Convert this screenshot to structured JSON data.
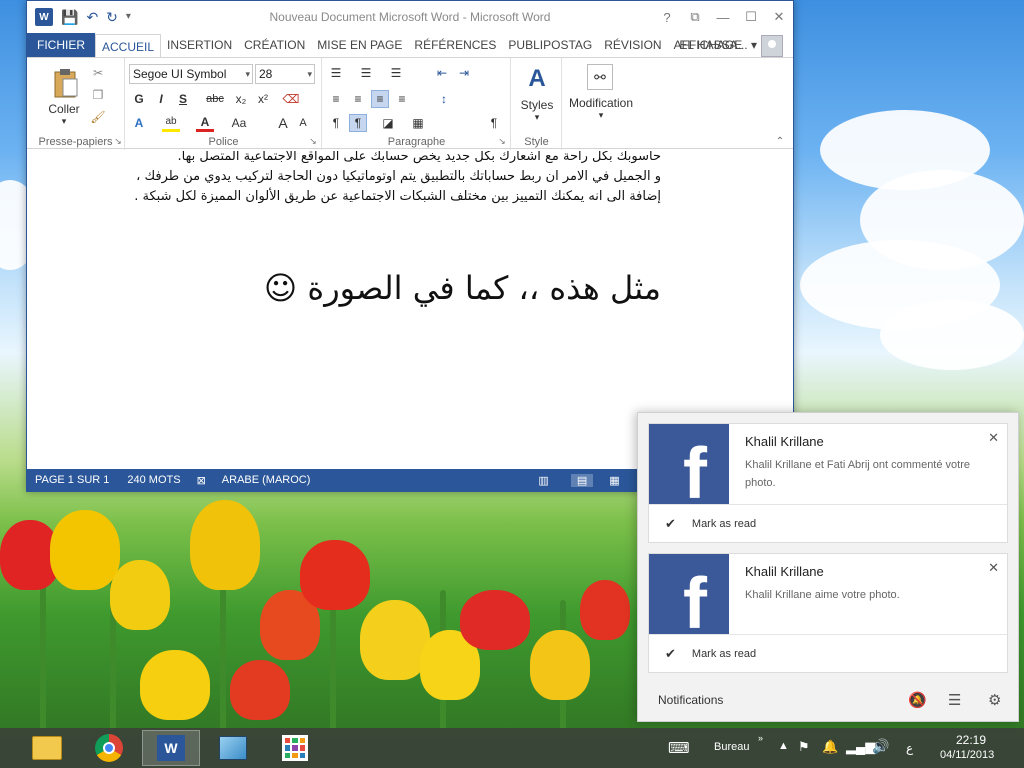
{
  "window": {
    "title": "Nouveau Document Microsoft Word - Microsoft Word",
    "controls": [
      "?",
      "⧉",
      "—",
      "☐",
      "✕"
    ]
  },
  "quick_access": {
    "app_icon_letter": "W",
    "save_icon": "💾",
    "undo_icon": "↶",
    "redo_icon": "↻",
    "customize_icon": "▾"
  },
  "tabs": [
    "FICHIER",
    "ACCUEIL",
    "INSERTION",
    "CRÉATION",
    "MISE EN PAGE",
    "RÉFÉRENCES",
    "PUBLIPOSTAG",
    "RÉVISION",
    "AFFICHAGE"
  ],
  "user": {
    "name": "EL HASSA... ▾"
  },
  "ribbon": {
    "clipboard": {
      "label": "Presse-papiers",
      "paste_label": "Coller"
    },
    "font": {
      "label": "Police",
      "font_name": "Segoe UI Symbol",
      "font_size": "28",
      "bold": "G",
      "italic": "I",
      "underline": "S",
      "strike": "abc",
      "sub": "x₂",
      "sup": "x²",
      "case": "Aa",
      "grow": "A",
      "shrink": "A"
    },
    "paragraph": {
      "label": "Paragraphe"
    },
    "styles": {
      "label": "Style",
      "styles_label": "Styles"
    },
    "editing": {
      "modification_label": "Modification"
    }
  },
  "document": {
    "lines": [
      "حاسوبك بكل راحة مع اشعارك بكل جديد يخص حسابك على المواقع الاجتماعية المتصل بها.",
      "و الجميل في الامر ان ربط حساباتك بالتطبيق يتم اوتوماتيكيا دون الحاجة لتركيب يدوي من طرفك ،",
      "إضافة الى انه يمكنك التمييز بين مختلف الشبكات الاجتماعية عن طريق الألوان المميزة لكل شبكة ."
    ],
    "big_line": "مثل هذه ،،  كما في الصورة ☺"
  },
  "statusbar": {
    "page": "PAGE 1 SUR 1",
    "words": "240 MOTS",
    "language": "ARABE (MAROC)"
  },
  "notifications": {
    "items": [
      {
        "title": "Khalil Krillane",
        "body": "Khalil Krillane et Fati Abrij ont commenté votre photo.",
        "mark_label": "Mark as read"
      },
      {
        "title": "Khalil Krillane",
        "body": "Khalil Krillane aime votre photo.",
        "mark_label": "Mark as read"
      }
    ],
    "footer_label": "Notifications",
    "fb_letter": "f"
  },
  "taskbar": {
    "bureau": "Bureau",
    "lang": "ع",
    "time": "22:19",
    "date": "04/11/2013"
  },
  "colors": {
    "word_blue": "#2b579a",
    "facebook_blue": "#3b5998"
  }
}
